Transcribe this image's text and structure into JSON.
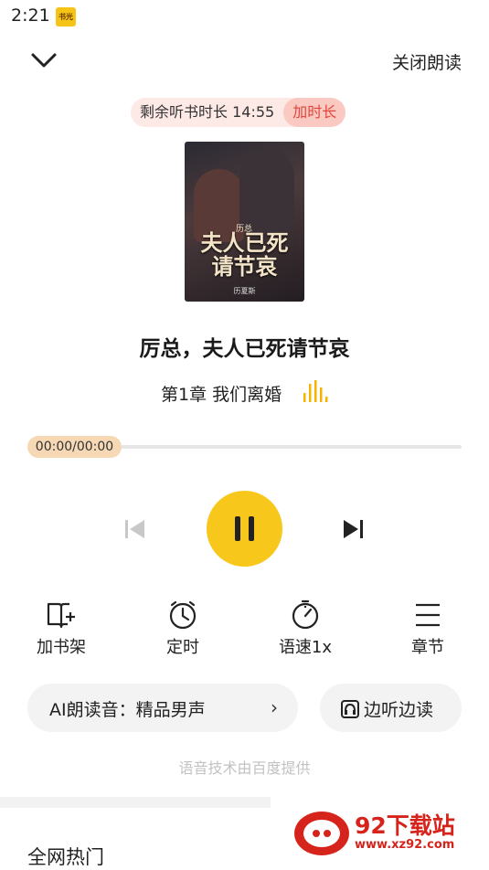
{
  "status_bar": {
    "time": "2:21",
    "app_icon_text": "书光"
  },
  "header": {
    "close_read_label": "关闭朗读"
  },
  "timer": {
    "label": "剩余听书时长 14:55",
    "add_label": "加时长"
  },
  "cover": {
    "series": "历总",
    "title_line1": "夫人已死",
    "title_line2": "请节哀",
    "author": "历夏斯"
  },
  "book": {
    "title": "厉总，夫人已死请节哀",
    "chapter": "第1章 我们离婚"
  },
  "progress": {
    "time": "00:00/00:00",
    "fraction": 0
  },
  "actions": [
    {
      "label": "加书架",
      "icon": "add-bookshelf-icon"
    },
    {
      "label": "定时",
      "icon": "alarm-clock-icon"
    },
    {
      "label": "语速1x",
      "icon": "speedometer-icon"
    },
    {
      "label": "章节",
      "icon": "menu-list-icon"
    }
  ],
  "voice": {
    "label": "AI朗读音：精品男声",
    "chevron": "›"
  },
  "listen_read": {
    "label": "边听边读"
  },
  "tech_note": "语音技术由百度提供",
  "section": {
    "title": "全网热门"
  },
  "watermark": {
    "title": "92下载站",
    "url": "www.xz92.com"
  },
  "colors": {
    "accent": "#f8c71b",
    "timer_bg": "#fde9e6",
    "timer_add": "#e2453a",
    "progress_thumb": "#f6d9b4"
  }
}
